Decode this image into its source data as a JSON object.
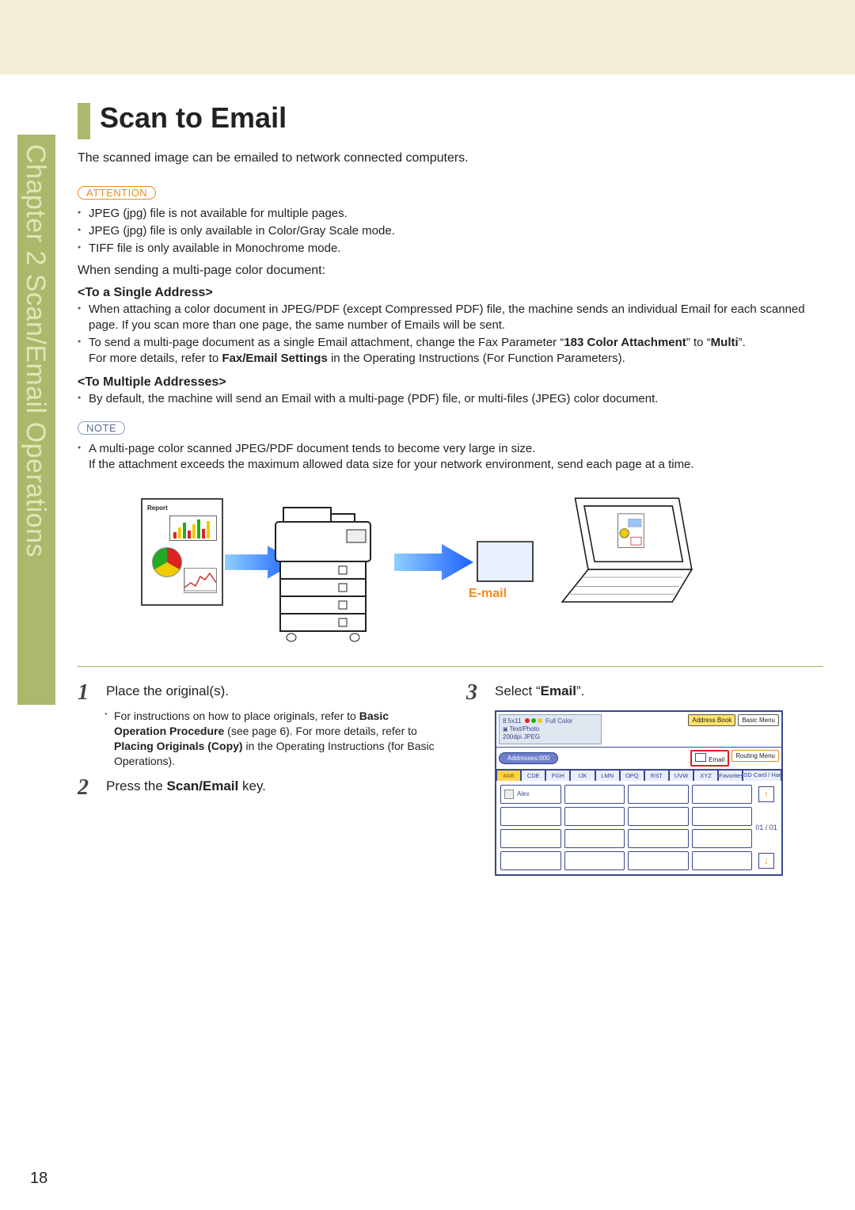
{
  "chapter_tab": "Chapter 2  Scan/Email Operations",
  "title": "Scan to Email",
  "intro": "The scanned image can be emailed to network connected computers.",
  "attention_label": "ATTENTION",
  "attention_bullets": [
    "JPEG (jpg) file is not available for multiple pages.",
    "JPEG (jpg) file is only available in Color/Gray Scale mode.",
    "TIFF file is only available in Monochrome mode."
  ],
  "multi_para": "When sending a multi-page color document:",
  "single_addr_head": "<To a Single Address>",
  "single_addr_b1": "When attaching a color document in JPEG/PDF (except Compressed PDF) file, the machine sends an individual Email for each scanned page. If you scan more than one page, the same number of Emails will be sent.",
  "single_addr_b2a": "To send a multi-page document as a single Email attachment, change the Fax Parameter “",
  "single_addr_b2_bold": "183 Color Attachment",
  "single_addr_b2b": "” to “",
  "single_addr_b2_bold2": "Multi",
  "single_addr_b2c": "”.",
  "single_addr_more_a": "For more details, refer to ",
  "single_addr_more_bold": "Fax/Email Settings",
  "single_addr_more_b": " in the Operating Instructions (For Function Parameters).",
  "multi_addr_head": "<To Multiple Addresses>",
  "multi_addr_b1": "By default, the machine will send an Email with a multi-page (PDF) file, or multi-files (JPEG) color document.",
  "note_label": "NOTE",
  "note_b1": "A multi-page color scanned JPEG/PDF document tends to become very large in size.",
  "note_b1_extra": "If the attachment exceeds the maximum allowed data size for your network environment, send each page at a time.",
  "email_label": "E-mail",
  "step1_text": "Place the original(s).",
  "step1_sub_a": "For instructions on how to place originals, refer to ",
  "step1_sub_bold1": "Basic Operation Procedure",
  "step1_sub_b": " (see page 6). For more details, refer to ",
  "step1_sub_bold2": "Placing Originals (Copy)",
  "step1_sub_c": " in the Operating Instructions (for Basic Operations).",
  "step2_a": "Press the ",
  "step2_bold": "Scan/Email",
  "step2_b": " key.",
  "step3_a": "Select “",
  "step3_bold": "Email",
  "step3_b": "”.",
  "screen": {
    "status_line1": "8.5x11",
    "status_color": "Full Color",
    "status_line2": "Text/Photo",
    "status_line3": "200dpi JPEG",
    "addr_count": "Addresses:000",
    "btn_addrbook": "Address Book",
    "btn_basicmenu": "Basic Menu",
    "btn_email": "Email",
    "btn_routing": "Routing Menu",
    "tabs": [
      "#AB",
      "CDE",
      "FGH",
      "IJK",
      "LMN",
      "OPQ",
      "RST",
      "UVW",
      "XYZ",
      "Favorites",
      "SD Card / Hard Drive"
    ],
    "first_entry": "Alex",
    "pager": "01 / 01"
  },
  "page_number": "18"
}
